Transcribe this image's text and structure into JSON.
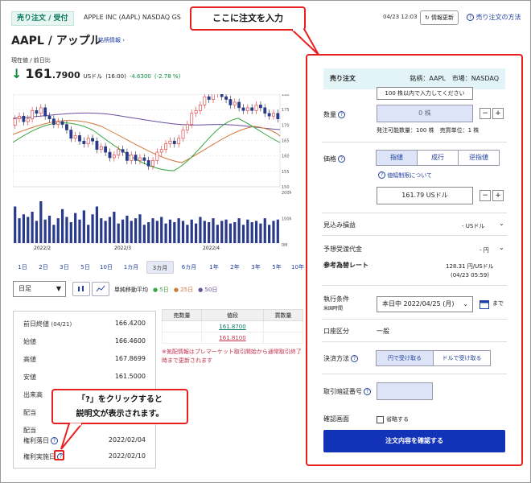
{
  "header": {
    "badge": "売り注文 / 受付",
    "symbol_line": "APPLE INC (AAPL) NASDAQ GS",
    "time": "04/23 12:03",
    "refresh_label": "情報更新",
    "help_link": "売り注文の方法",
    "title": "AAPL / アップル",
    "stock_info_link": "銘柄情報 ›",
    "price_label": "現在値 / 前日比",
    "price_int": "161",
    "price_dec": ".7900",
    "price_unit": "USドル",
    "price_time": "(16:00)",
    "price_change": "-4.6300",
    "price_change_pct": "(-2.78 %)"
  },
  "chart_data": {
    "type": "candlestick",
    "y_ticks": [
      "180",
      "175",
      "170",
      "165",
      "160",
      "155",
      "150"
    ],
    "ylim": [
      150,
      180
    ],
    "x_ticks": [
      "2022/2",
      "2022/3",
      "2022/4"
    ],
    "volume_ticks": [
      "200M",
      "100M",
      "0M"
    ]
  },
  "period_tabs": [
    "1日",
    "2日",
    "3日",
    "5日",
    "10日",
    "1カ月",
    "3カ月",
    "6カ月",
    "1年",
    "2年",
    "3年",
    "5年",
    "10年"
  ],
  "controls": {
    "interval": "日足",
    "ma_label": "単純移動平均",
    "ma5": "5日",
    "ma25": "25日",
    "ma50": "50日"
  },
  "stats": [
    {
      "label": "前日終値",
      "sub": "(04/21)",
      "value": "166.4200"
    },
    {
      "label": "始値",
      "value": "166.4600"
    },
    {
      "label": "高値",
      "value": "167.8699"
    },
    {
      "label": "安値",
      "value": "161.5000"
    },
    {
      "label": "出来高",
      "value": ""
    },
    {
      "label": "配当",
      "value": ""
    },
    {
      "label": "配当",
      "value": ""
    },
    {
      "label": "権利落日",
      "value": "2022/02/04"
    },
    {
      "label": "権利実施日",
      "value": "2022/02/10"
    }
  ],
  "board": {
    "headers": [
      "売数量",
      "値段",
      "買数量"
    ],
    "rows": [
      {
        "sell": "",
        "price": "161.8700",
        "buy": ""
      },
      {
        "sell": "",
        "price": "161.8100",
        "buy": ""
      }
    ],
    "notice": "※気配情報はプレマーケット取引開始から通常取引終了時まで更新されます"
  },
  "order": {
    "head_title": "売り注文",
    "head_info": "銘柄：AAPL　市場：NASDAQ",
    "qty_label": "数量",
    "qty_tooltip": "100 株以内で入力してください",
    "qty_value": "0 株",
    "qty_note1": "発注可能数量：100 株",
    "qty_note2": "売買単位：1 株",
    "price_label": "価格",
    "price_types": [
      "指値",
      "成行",
      "逆指値"
    ],
    "price_limit_link": "値幅制限について",
    "price_value": "161.79 USドル",
    "est_amount_label": "見込み損益",
    "est_amount_value": "- USドル",
    "est_recv_label": "予想受渡代金",
    "est_recv_value": "- 円",
    "ref_rate_label": "参考為替レート",
    "ref_rate_value": "128.31 円/USドル",
    "ref_rate_time": "(04/23 05:59)",
    "cond_label": "執行条件",
    "cond_sub": "米国時間",
    "cond_value": "本日中 2022/04/25 (月)",
    "cond_until": "まで",
    "account_label": "口座区分",
    "account_value": "一般",
    "settle_label": "決済方法",
    "settle_options": [
      "円で受け取る",
      "ドルで受け取る"
    ],
    "pin_label": "取引暗証番号",
    "confirm_label": "確認画面",
    "skip_label": "省略する",
    "submit_label": "注文内容を確認する"
  },
  "callouts": {
    "top": "ここに注文を入力",
    "bottom_line1": "「?」をクリックすると",
    "bottom_line2": "説明文が表示されます。"
  }
}
